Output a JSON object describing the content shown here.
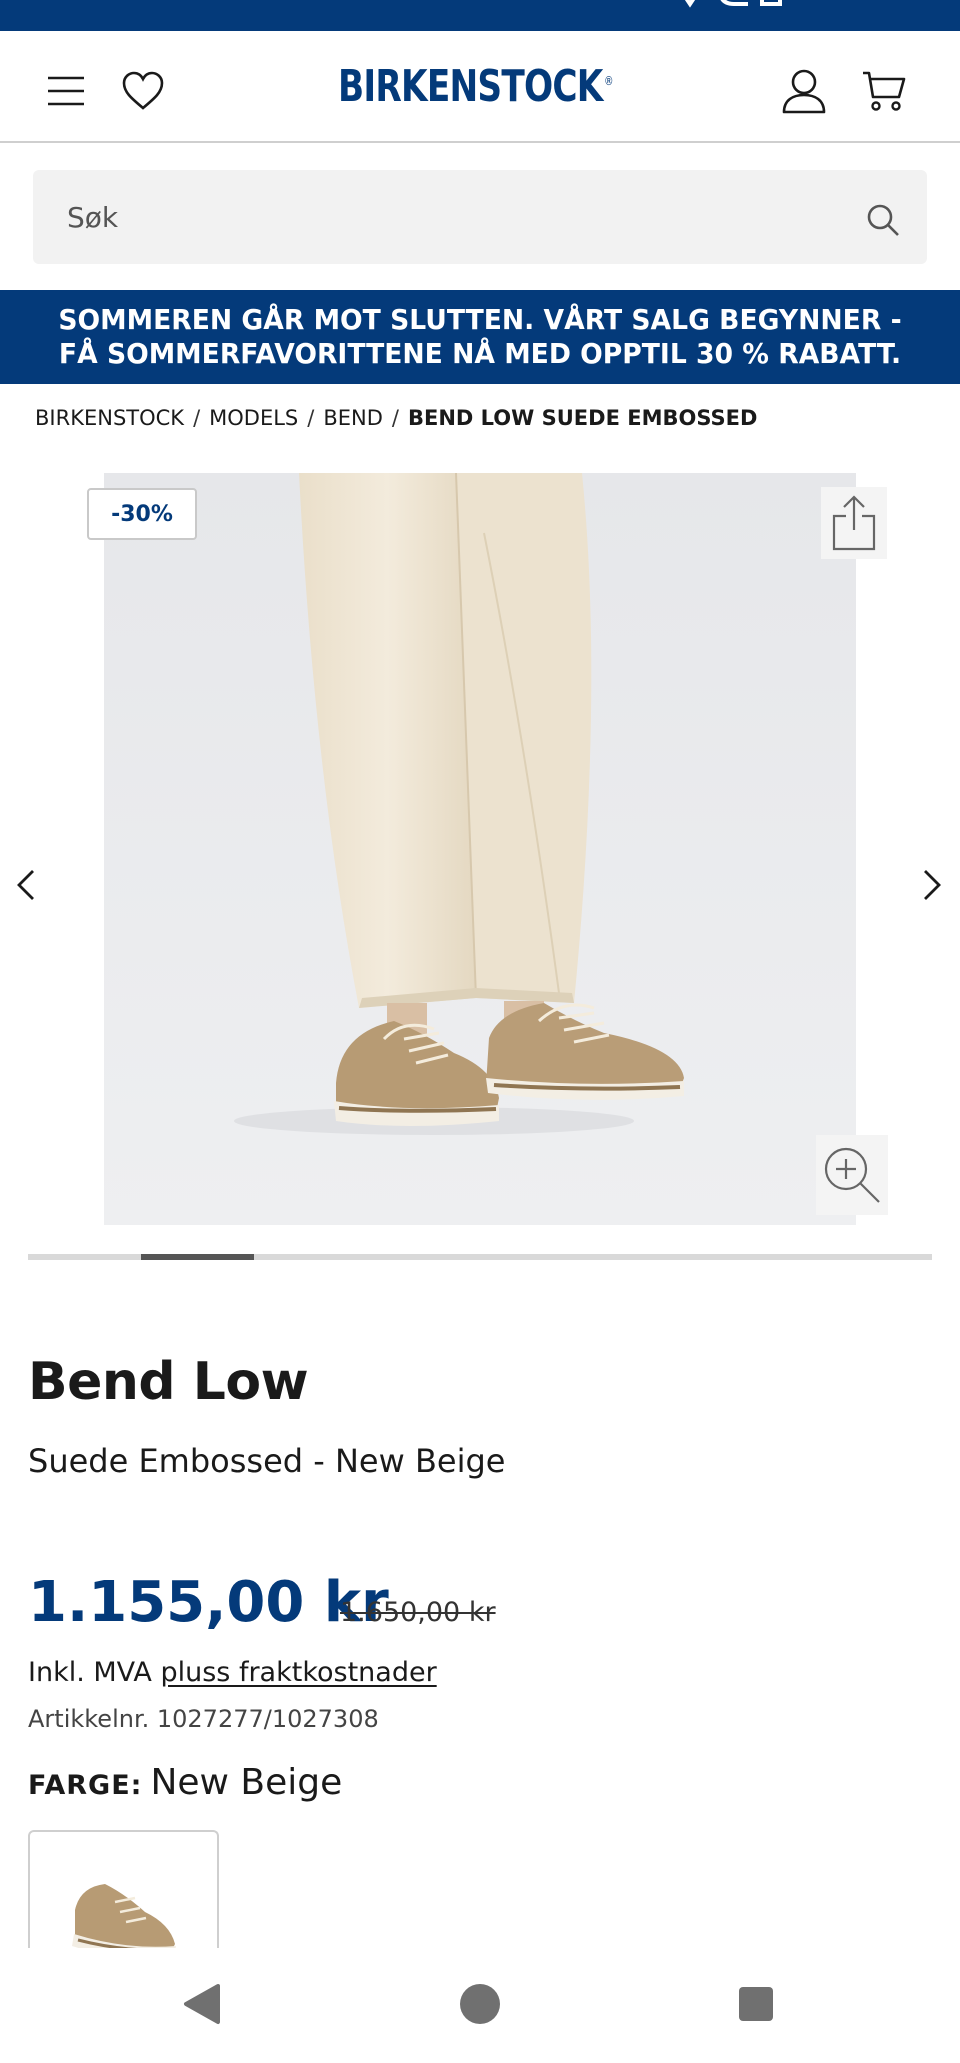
{
  "header": {
    "brand": "BIRKENSTOCK",
    "registered_mark": "®"
  },
  "search": {
    "placeholder": "Søk"
  },
  "promo": {
    "text": "SOMMEREN GÅR MOT SLUTTEN. VÅRT SALG BEGYNNER - FÅ SOMMERFAVORITTENE NÅ MED OPPTIL 30 % RABATT."
  },
  "breadcrumb": {
    "items": [
      "BIRKENSTOCK",
      "MODELS",
      "BEND"
    ],
    "current": "BEND LOW SUEDE EMBOSSED",
    "separator": "/"
  },
  "gallery": {
    "discount_badge": "-30%",
    "progress_fraction": 0.125,
    "active_index": 1
  },
  "product": {
    "name": "Bend Low",
    "variant": "Suede Embossed - New Beige",
    "price": "1.155,00 kr",
    "old_price": "1.650,00 kr",
    "vat_prefix": "Inkl. MVA",
    "shipping_link": "pluss fraktkostnader",
    "article_number": "Artikkelnr. 1027277/1027308",
    "color_label": "FARGE:",
    "color_value": "New Beige"
  },
  "colors": {
    "brand_blue": "#043a7a",
    "pants": "#efe6d6",
    "shoe": "#b59a75",
    "background": "#e9eaec"
  }
}
